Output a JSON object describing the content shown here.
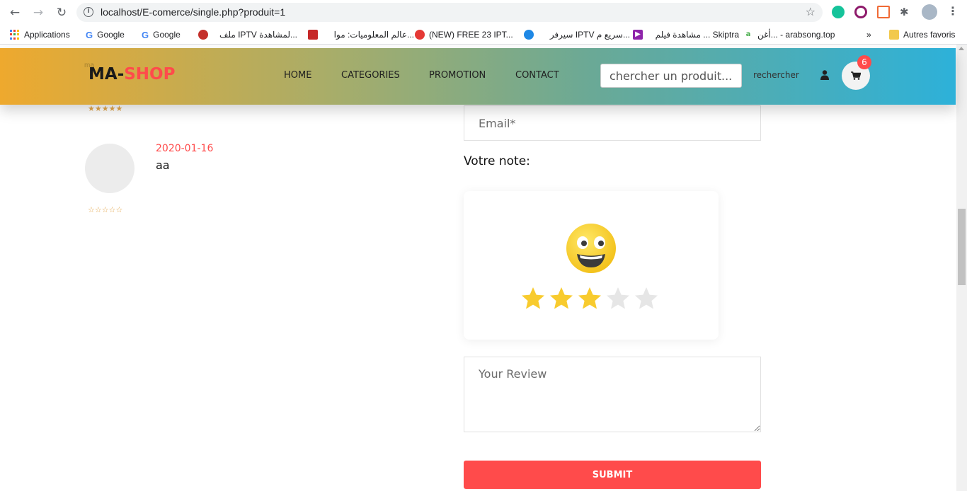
{
  "browser": {
    "url": "localhost/E-comerce/single.php?produit=1",
    "bookmarks": [
      "Applications",
      "Google",
      "Google",
      "ملف IPTV لمشاهدة...",
      "عالم المعلوميات: موا...",
      "(NEW) FREE 23 IPT...",
      "سيرفر IPTV سريع م...",
      "مشاهدة فيلم ... Skiptra",
      "أغن... - arabsong.top"
    ],
    "bookmarks_more": "»",
    "other_bookmarks": "Autres favoris"
  },
  "header": {
    "logo_prefix": "MA-",
    "logo_suffix": "SHOP",
    "logo_ghost": "ma",
    "menu": [
      "HOME",
      "CATEGORIES",
      "PROMOTION",
      "CONTACT"
    ],
    "search_placeholder": "chercher un produit....",
    "search_button": "rechercher",
    "cart_count": "6"
  },
  "reviews": [
    {
      "rating": 5,
      "date": "",
      "text": ""
    },
    {
      "rating": 0,
      "date": "2020-01-16",
      "text": "aa"
    }
  ],
  "form": {
    "email_placeholder": "Email*",
    "rating_label": "Votre note:",
    "rating_value": 3,
    "rating_max": 5,
    "review_placeholder": "Your Review",
    "submit_label": "SUBMIT"
  },
  "colors": {
    "accent": "#ff4b4b",
    "star_filled": "#f8cb2e",
    "star_empty": "#e6e6e6",
    "review_star": "#e3a64a"
  }
}
